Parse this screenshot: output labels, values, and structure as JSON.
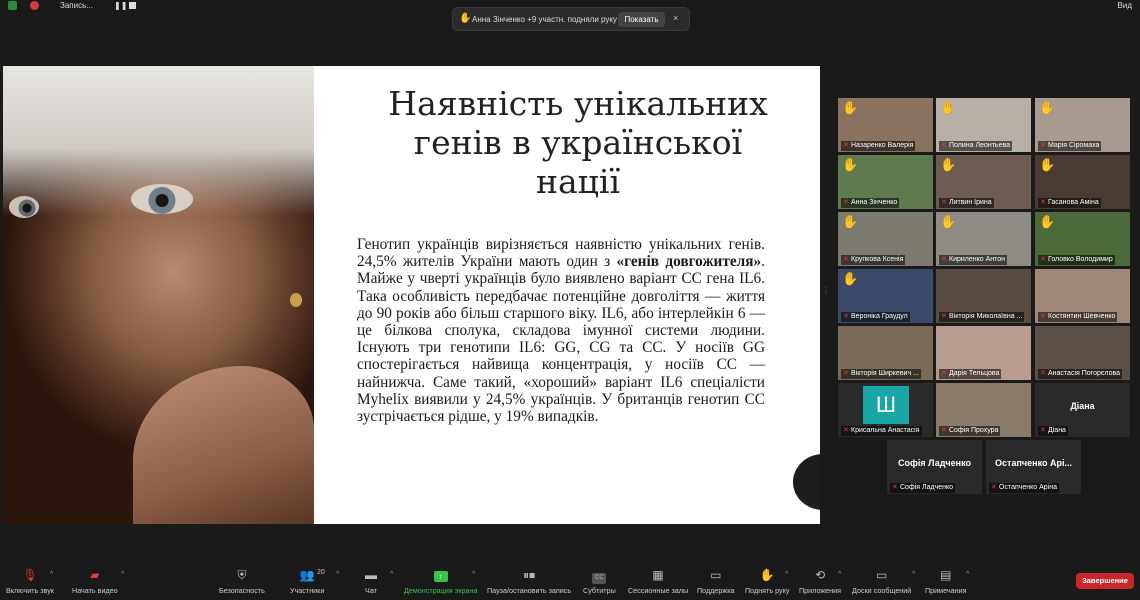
{
  "topbar": {
    "recording_label": "Запись...",
    "pause_icon": "pause-icon",
    "view_label": "Вид"
  },
  "notification": {
    "text": "Анна Зінченко +9 участн. подняли руку",
    "show_button": "Показать",
    "close_symbol": "×"
  },
  "slide": {
    "title_line1": "Наявність унікальних",
    "title_line2": "генів в української",
    "title_line3": "нації",
    "body_part1": "Генотип українців вирізняється наявністю унікальних генів. 24,5% жителів України мають один з ",
    "body_bold": "«генів довгожителя»",
    "body_part2": ". Майже у чверті українців було виявлено варіант CC гена IL6. Така особливість передбачає потенційне довголіття — життя до 90 років або більш старшого віку. IL6, або інтерлейкін 6 — це білкова сполука, складова імунної системи людини. Існують три генотипи IL6: GG, CG та CC. У носіїв GG спостерігається найвища концентрація, у носіїв CC — найнижча. Саме такий, «хороший» варіант IL6 спеціалісти Myhelix виявили у 24,5% українців. У британців генотип CC зустрічається рідше, у 19% випадків."
  },
  "participants": [
    {
      "name": "Назаренко Валерія",
      "hand": true,
      "bg": "#8a7260"
    },
    {
      "name": "Полина Леонтьева",
      "hand": true,
      "bg": "#b8b0a6"
    },
    {
      "name": "Марія Сіромаха",
      "hand": true,
      "bg": "#a89a90"
    },
    {
      "name": "Анна Зінченко",
      "hand": true,
      "bg": "#5f7a4e"
    },
    {
      "name": "Литвин Ірина",
      "hand": true,
      "bg": "#6c5c52"
    },
    {
      "name": "Гасанова Аміна",
      "hand": true,
      "bg": "#4a3a34"
    },
    {
      "name": "Крупкова Ксенія",
      "hand": true,
      "bg": "#7d7a70"
    },
    {
      "name": "Кириленко Антон",
      "hand": true,
      "bg": "#8e8a84"
    },
    {
      "name": "Головко Володимир",
      "hand": true,
      "bg": "#4c6a3a"
    },
    {
      "name": "Вероніка Граудул",
      "hand": true,
      "bg": "#3a4a68"
    },
    {
      "name": "Вікторія Миколаївна ...",
      "hand": false,
      "bg": "#5a4c44"
    },
    {
      "name": "Костянтин Шевченко",
      "hand": false,
      "bg": "#a08878"
    },
    {
      "name": "Вікторія Ширкевич ...",
      "hand": false,
      "bg": "#7a6a58"
    },
    {
      "name": "Дарія Тельцова",
      "hand": false,
      "bg": "#b89c90"
    },
    {
      "name": "Анастасія Погорєлова",
      "hand": false,
      "bg": "#5a5048"
    },
    {
      "name": "Крисальна Анастасія",
      "hand": false,
      "bg": "#2a2a2a",
      "initial": "Ш"
    },
    {
      "name": "Софія Прохура",
      "hand": false,
      "bg": "#8a7a6a"
    },
    {
      "name": "Діана",
      "hand": false,
      "bg": "#2a2a2a",
      "center": "Діана"
    },
    {
      "name": "Софія Ладченко",
      "hand": false,
      "bg": "#2a2a2a",
      "center": "Софія Ладченко"
    },
    {
      "name": "Остапченко Аріна",
      "hand": false,
      "bg": "#2a2a2a",
      "center": "Остапченко  Арі..."
    }
  ],
  "toolbar": {
    "unmute": "Включить звук",
    "start_video": "Начать видео",
    "security": "Безопасность",
    "participants": "Участники",
    "participants_count": "20",
    "chat": "Чат",
    "share_screen": "Демонстрация экрана",
    "pause_recording": "Пауза/остановить запись",
    "captions": "Субтитры",
    "captions_icon_text": "CC",
    "breakout_rooms": "Сессионные залы",
    "support": "Поддержка",
    "raise_hand": "Поднять руку",
    "apps": "Приложения",
    "whiteboards": "Доски сообщений",
    "notes": "Примечания",
    "end": "Завершение",
    "accent": "#38c24a",
    "end_color": "#c8262a"
  }
}
